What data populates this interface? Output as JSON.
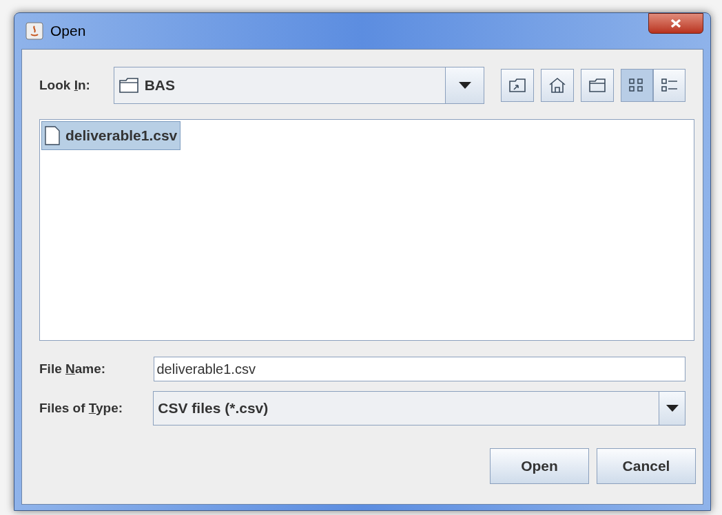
{
  "window": {
    "title": "Open"
  },
  "look_in": {
    "label": [
      "Look ",
      "I",
      "n:"
    ],
    "value": "BAS"
  },
  "toolbar": [
    {
      "kind": "up"
    },
    {
      "kind": "home"
    },
    {
      "kind": "new-folder"
    },
    {
      "kind": "list",
      "selected": true
    },
    {
      "kind": "details",
      "selected": false
    }
  ],
  "files": [
    {
      "name": "deliverable1.csv",
      "selected": true
    }
  ],
  "file_name": {
    "label": [
      "File ",
      "N",
      "ame:"
    ],
    "value": "deliverable1.csv"
  },
  "file_type": {
    "label": [
      "Files of ",
      "T",
      "ype:"
    ],
    "value": "CSV files (*.csv)"
  },
  "buttons": [
    "Open",
    "Cancel"
  ]
}
